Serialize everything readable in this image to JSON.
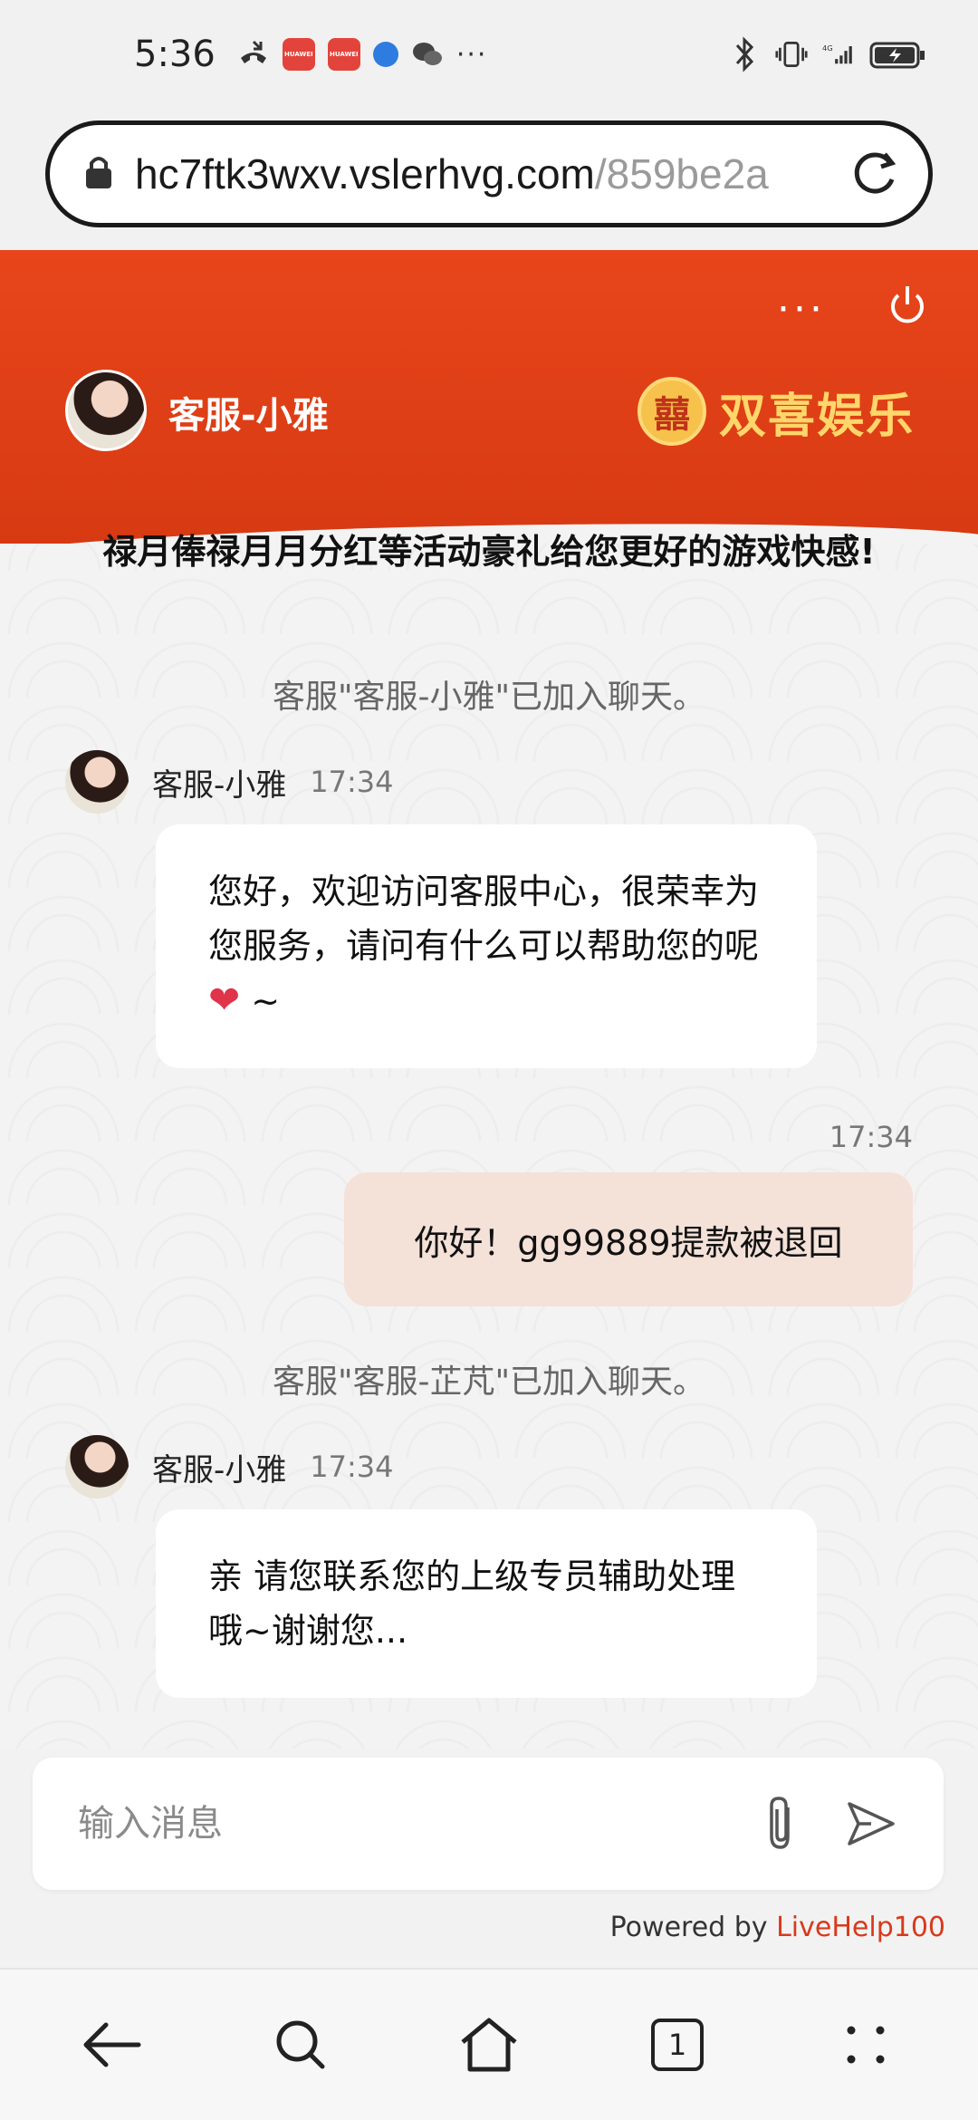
{
  "status_bar": {
    "time": "5:36",
    "app_icon_label": "HUAWEI",
    "more": "···",
    "network": "4G"
  },
  "browser": {
    "url_domain": "hc7ftk3wxv.vslerhvg.com",
    "url_path": "/859be2a"
  },
  "header": {
    "agent_name": "客服-小雅",
    "brand_name": "双喜娱乐",
    "brand_emblem": "囍",
    "more_label": "···"
  },
  "chat": {
    "promo_text": "禄月俸禄月月分红等活动豪礼给您更好的游戏快感!",
    "system_join_1": "客服\"客服-小雅\"已加入聊天。",
    "msg1": {
      "name": "客服-小雅",
      "time": "17:34",
      "text": "您好，欢迎访问客服中心，很荣幸为您服务，请问有什么可以帮助您的呢",
      "emoji": "❤",
      "suffix": " ~"
    },
    "out_time": "17:34",
    "out_text": "你好！gg99889提款被退回",
    "system_join_2": "客服\"客服-芷芃\"已加入聊天。",
    "msg2": {
      "name": "客服-小雅",
      "time": "17:34",
      "text": "亲 请您联系您的上级专员辅助处理哦~谢谢您..."
    }
  },
  "input": {
    "placeholder": "输入消息"
  },
  "footer": {
    "powered_prefix": "Powered by ",
    "powered_link": "LiveHelp100"
  },
  "nav": {
    "tab_count": "1"
  },
  "colors": {
    "header_red": "#e8451b",
    "brand_gold": "#ffd66a",
    "outgoing_bubble": "#f4e1d8",
    "link_red": "#d9391a"
  }
}
